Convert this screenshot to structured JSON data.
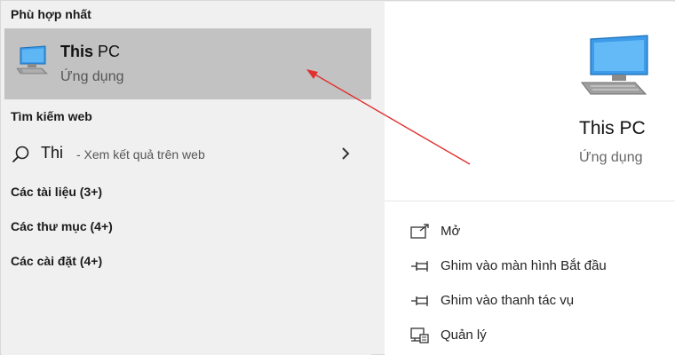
{
  "left": {
    "best_match_heading": "Phù hợp nhất",
    "best_match": {
      "title_bold": "This",
      "title_rest": " PC",
      "subtitle": "Ứng dụng",
      "icon": "pc-icon"
    },
    "web_heading": "Tìm kiếm web",
    "web_result": {
      "query": "Thi",
      "hint": "- Xem kết quả trên web",
      "icon": "search-icon"
    },
    "categories": [
      "Các tài liệu (3+)",
      "Các thư mục (4+)",
      "Các cài đặt (4+)"
    ]
  },
  "right": {
    "preview": {
      "name": "This PC",
      "kind": "Ứng dụng",
      "icon": "pc-icon"
    },
    "actions": [
      {
        "label": "Mở",
        "icon": "open-icon"
      },
      {
        "label": "Ghim vào màn hình Bắt đầu",
        "icon": "pin-icon"
      },
      {
        "label": "Ghim vào thanh tác vụ",
        "icon": "pin-icon"
      },
      {
        "label": "Quản lý",
        "icon": "manage-icon"
      }
    ]
  },
  "colors": {
    "selected_bg": "#c2c2c2",
    "pane_bg": "#f0f0f0",
    "arrow": "#e03030"
  }
}
